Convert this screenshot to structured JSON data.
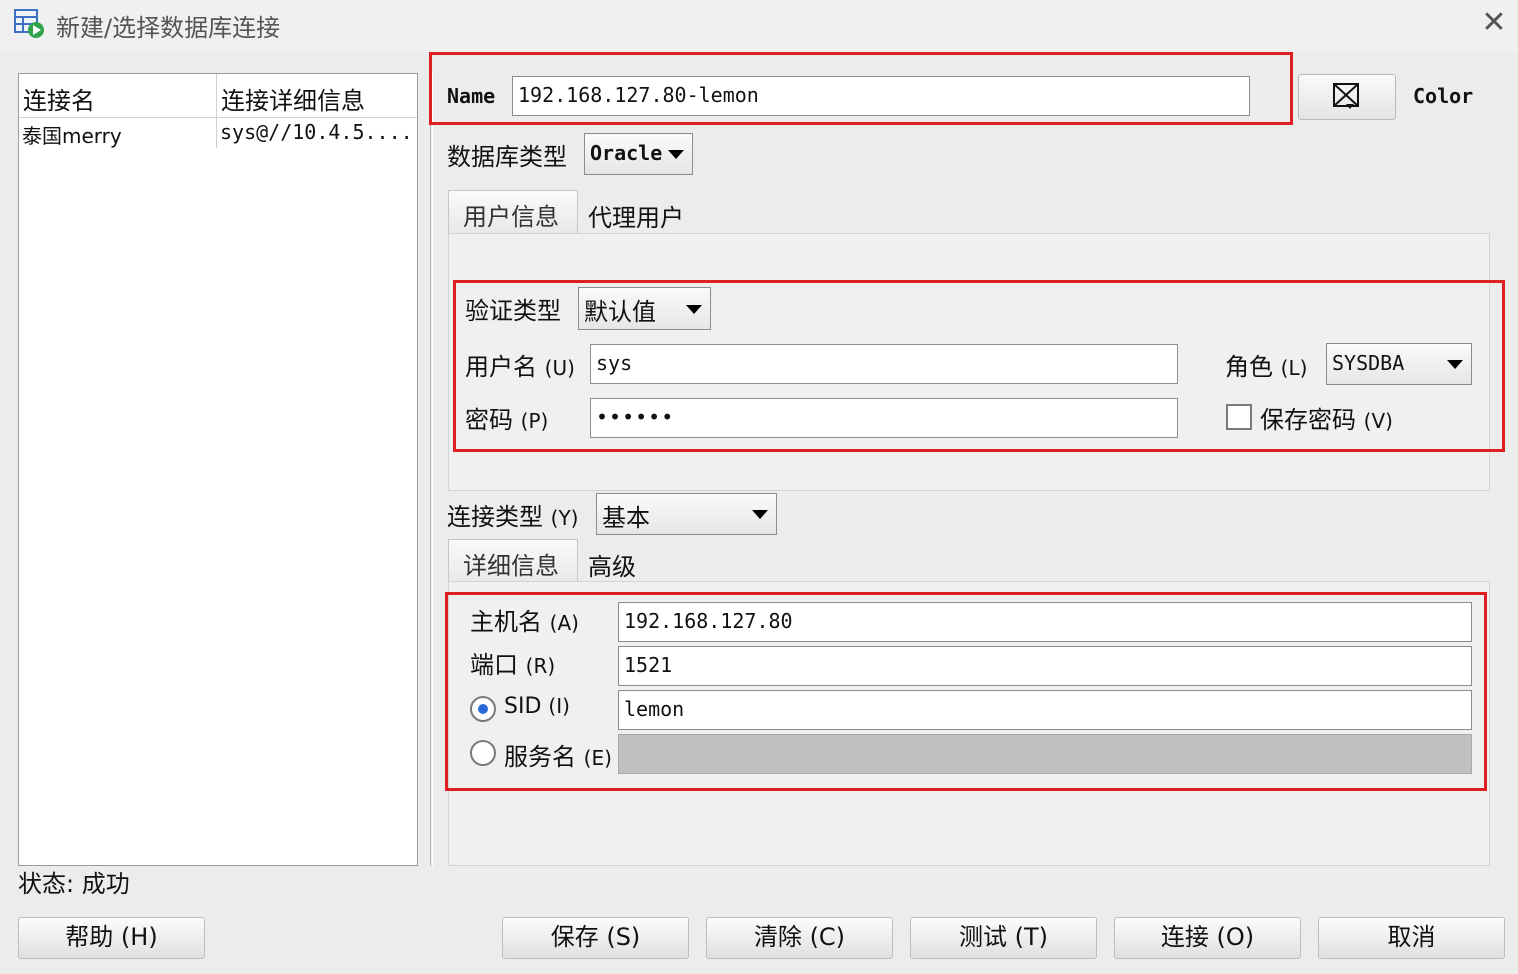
{
  "window": {
    "title": "新建/选择数据库连接"
  },
  "connections": {
    "headers": [
      "连接名",
      "连接详细信息"
    ],
    "rows": [
      {
        "name": "泰国merry",
        "detail": "sys@//10.4.5...."
      }
    ]
  },
  "status": {
    "label": "状态:",
    "value": "成功"
  },
  "name_field": {
    "label": "Name",
    "value": "192.168.127.80-lemon"
  },
  "color_button": {
    "label": "Color",
    "icon": "color-picker-icon"
  },
  "db_type": {
    "label": "数据库类型",
    "value": "Oracle"
  },
  "user_tabs": [
    {
      "label": "用户信息",
      "active": true
    },
    {
      "label": "代理用户",
      "active": false
    }
  ],
  "auth": {
    "type_label": "验证类型",
    "type_value": "默认值",
    "username_label": "用户名",
    "username_mnemonic": "(U)",
    "username_value": "sys",
    "password_label": "密码",
    "password_mnemonic": "(P)",
    "password_value": "••••••",
    "role_label": "角色",
    "role_mnemonic": "(L)",
    "role_value": "SYSDBA",
    "save_password_label": "保存密码",
    "save_password_mnemonic": "(V)",
    "save_password_checked": false
  },
  "connection_type": {
    "label": "连接类型",
    "mnemonic": "(Y)",
    "value": "基本"
  },
  "detail_tabs": [
    {
      "label": "详细信息",
      "active": true
    },
    {
      "label": "高级",
      "active": false
    }
  ],
  "details": {
    "host_label": "主机名",
    "host_mnemonic": "(A)",
    "host_value": "192.168.127.80",
    "port_label": "端口",
    "port_mnemonic": "(R)",
    "port_value": "1521",
    "sid_label": "SID",
    "sid_mnemonic": "(I)",
    "sid_value": "lemon",
    "sid_selected": true,
    "service_label": "服务名",
    "service_mnemonic": "(E)",
    "service_value": ""
  },
  "buttons": {
    "help": "帮助 (H)",
    "save": "保存 (S)",
    "clear": "清除 (C)",
    "test": "测试 (T)",
    "connect": "连接 (O)",
    "cancel": "取消"
  },
  "colors": {
    "highlight_border": "#e02020",
    "radio_dot": "#2a6ad8"
  }
}
